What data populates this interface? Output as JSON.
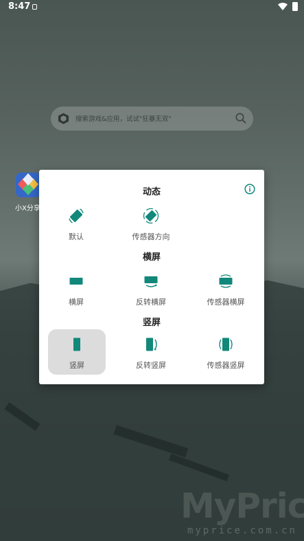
{
  "status_bar": {
    "time": "8:47"
  },
  "search": {
    "placeholder": "搜索游戏&应用，试试\"狂暴无双\""
  },
  "home": {
    "app_label": "小X分享"
  },
  "dialog": {
    "sections": [
      {
        "title": "动态",
        "options": [
          {
            "label": "默认",
            "icon": "rotate-default-icon"
          },
          {
            "label": "传感器方向",
            "icon": "sensor-rotate-icon"
          }
        ]
      },
      {
        "title": "横屏",
        "options": [
          {
            "label": "横屏",
            "icon": "landscape-icon"
          },
          {
            "label": "反转横屏",
            "icon": "reverse-landscape-icon"
          },
          {
            "label": "传感器横屏",
            "icon": "sensor-landscape-icon"
          }
        ]
      },
      {
        "title": "竖屏",
        "options": [
          {
            "label": "竖屏",
            "icon": "portrait-icon",
            "selected": true
          },
          {
            "label": "反转竖屏",
            "icon": "reverse-portrait-icon"
          },
          {
            "label": "传感器竖屏",
            "icon": "sensor-portrait-icon"
          }
        ]
      }
    ]
  },
  "watermark": {
    "title": "MyPrice",
    "subtitle": "myprice.com.cn"
  },
  "colors": {
    "accent": "#11887a",
    "selected_bg": "#dcdcdc"
  }
}
